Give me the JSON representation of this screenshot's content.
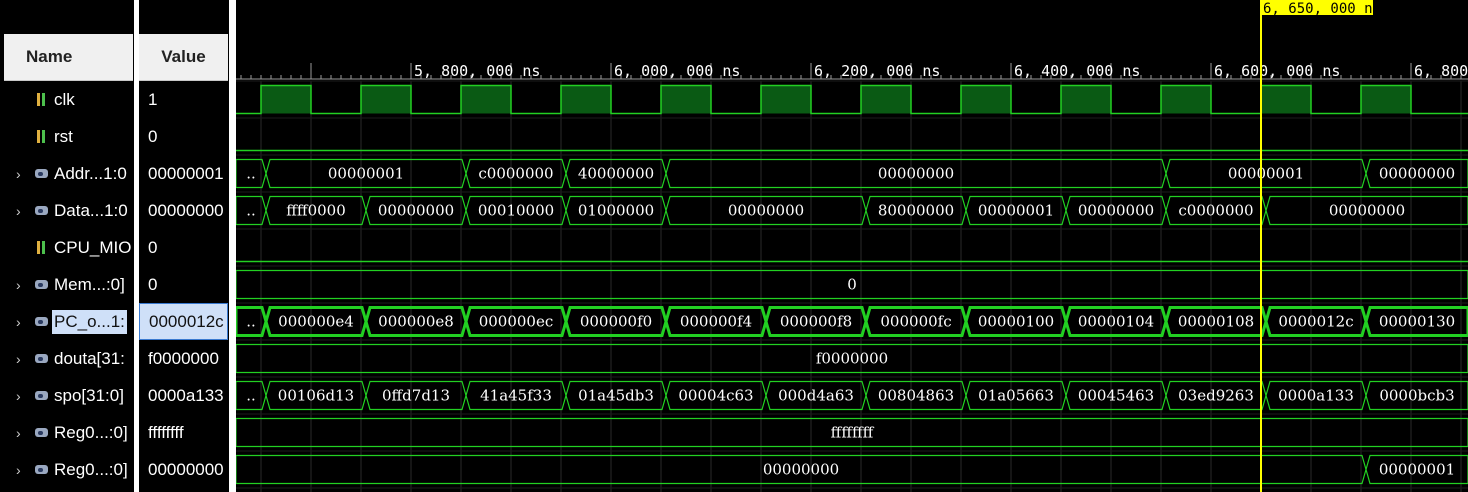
{
  "header": {
    "name_label": "Name",
    "value_label": "Value"
  },
  "timeline": {
    "unit": "ns",
    "visible_start_ns": 5625,
    "visible_end_ns": 6857,
    "labels": [
      "5, 800, 000 ns",
      "6, 000, 000 ns",
      "6, 200, 000 ns",
      "6, 400, 000 ns",
      "6, 600, 000 ns",
      "6, 800,"
    ],
    "label_times_ns": [
      5800,
      6000,
      6200,
      6400,
      6600,
      6800
    ],
    "cursor_label": "6, 650, 000 ns",
    "cursor_time_ns": 6650
  },
  "colors": {
    "wave": "#22d022",
    "wave_fill": "#0a5a14",
    "grid": "#2a2a2a",
    "cursor": "#ffff00",
    "selected_bg": "#cfe0f8"
  },
  "signals": [
    {
      "name": "clk",
      "value": "1",
      "kind": "bit",
      "icon": "bit-signal-icon",
      "expandable": false
    },
    {
      "name": "rst",
      "value": "0",
      "kind": "bit",
      "icon": "bit-signal-icon",
      "expandable": false
    },
    {
      "name": "Addr...1:0",
      "value": "00000001",
      "kind": "bus",
      "icon": "bus-signal-icon",
      "expandable": true
    },
    {
      "name": "Data...1:0",
      "value": "00000000",
      "kind": "bus",
      "icon": "bus-signal-icon",
      "expandable": true
    },
    {
      "name": "CPU_MIO",
      "value": "0",
      "kind": "bit",
      "icon": "bit-signal-icon",
      "expandable": false
    },
    {
      "name": "Mem...:0]",
      "value": "0",
      "kind": "bus",
      "icon": "bus-signal-icon",
      "expandable": true
    },
    {
      "name": "PC_o...1:",
      "value": "0000012c",
      "kind": "bus",
      "icon": "bus-signal-icon",
      "expandable": true,
      "selected": true
    },
    {
      "name": "douta[31:",
      "value": "f0000000",
      "kind": "bus",
      "icon": "bus-signal-icon",
      "expandable": true
    },
    {
      "name": "spo[31:0]",
      "value": "0000a133",
      "kind": "bus",
      "icon": "bus-signal-icon",
      "expandable": true
    },
    {
      "name": "Reg0...:0]",
      "value": "ffffffff",
      "kind": "bus",
      "icon": "bus-signal-icon",
      "expandable": true
    },
    {
      "name": "Reg0...:0]",
      "value": "00000000",
      "kind": "bus",
      "icon": "bus-signal-icon",
      "expandable": true
    }
  ],
  "waves": {
    "clk": {
      "period_ns": 100,
      "high_ranges": [
        [
          5650,
          5700
        ],
        [
          5750,
          5800
        ],
        [
          5850,
          5900
        ],
        [
          5950,
          6000
        ],
        [
          6050,
          6100
        ],
        [
          6150,
          6200
        ],
        [
          6250,
          6300
        ],
        [
          6350,
          6400
        ],
        [
          6450,
          6500
        ],
        [
          6550,
          6600
        ],
        [
          6650,
          6700
        ],
        [
          6750,
          6800
        ]
      ]
    },
    "rst": {
      "level": 0
    },
    "cpu_mio": {
      "level": 0
    },
    "buses": [
      {
        "row": 2,
        "segments": [
          {
            "start": 5625,
            "end": 5655,
            "label": ".."
          },
          {
            "start": 5655,
            "end": 5855,
            "label": "00000001"
          },
          {
            "start": 5855,
            "end": 5955,
            "label": "c0000000"
          },
          {
            "start": 5955,
            "end": 6055,
            "label": "40000000"
          },
          {
            "start": 6055,
            "end": 6555,
            "label": "00000000"
          },
          {
            "start": 6555,
            "end": 6755,
            "label": "00000001"
          },
          {
            "start": 6755,
            "end": 6857,
            "label": "00000000"
          }
        ]
      },
      {
        "row": 3,
        "segments": [
          {
            "start": 5625,
            "end": 5655,
            "label": ".."
          },
          {
            "start": 5655,
            "end": 5755,
            "label": "ffff0000"
          },
          {
            "start": 5755,
            "end": 5855,
            "label": "00000000"
          },
          {
            "start": 5855,
            "end": 5955,
            "label": "00010000"
          },
          {
            "start": 5955,
            "end": 6055,
            "label": "01000000"
          },
          {
            "start": 6055,
            "end": 6255,
            "label": "00000000"
          },
          {
            "start": 6255,
            "end": 6355,
            "label": "80000000"
          },
          {
            "start": 6355,
            "end": 6455,
            "label": "00000001"
          },
          {
            "start": 6455,
            "end": 6555,
            "label": "00000000"
          },
          {
            "start": 6555,
            "end": 6655,
            "label": "c0000000"
          },
          {
            "start": 6655,
            "end": 6857,
            "label": "00000000"
          }
        ]
      },
      {
        "row": 5,
        "segments": [
          {
            "start": 5625,
            "end": 6857,
            "label": "0"
          }
        ]
      },
      {
        "row": 6,
        "bold": true,
        "segments": [
          {
            "start": 5625,
            "end": 5655,
            "label": ".."
          },
          {
            "start": 5655,
            "end": 5755,
            "label": "000000e4"
          },
          {
            "start": 5755,
            "end": 5855,
            "label": "000000e8"
          },
          {
            "start": 5855,
            "end": 5955,
            "label": "000000ec"
          },
          {
            "start": 5955,
            "end": 6055,
            "label": "000000f0"
          },
          {
            "start": 6055,
            "end": 6155,
            "label": "000000f4"
          },
          {
            "start": 6155,
            "end": 6255,
            "label": "000000f8"
          },
          {
            "start": 6255,
            "end": 6355,
            "label": "000000fc"
          },
          {
            "start": 6355,
            "end": 6455,
            "label": "00000100"
          },
          {
            "start": 6455,
            "end": 6555,
            "label": "00000104"
          },
          {
            "start": 6555,
            "end": 6655,
            "label": "00000108"
          },
          {
            "start": 6655,
            "end": 6755,
            "label": "0000012c"
          },
          {
            "start": 6755,
            "end": 6857,
            "label": "00000130"
          }
        ]
      },
      {
        "row": 7,
        "segments": [
          {
            "start": 5625,
            "end": 6857,
            "label": "f0000000"
          }
        ]
      },
      {
        "row": 8,
        "segments": [
          {
            "start": 5625,
            "end": 5655,
            "label": ".."
          },
          {
            "start": 5655,
            "end": 5755,
            "label": "00106d13"
          },
          {
            "start": 5755,
            "end": 5855,
            "label": "0ffd7d13"
          },
          {
            "start": 5855,
            "end": 5955,
            "label": "41a45f33"
          },
          {
            "start": 5955,
            "end": 6055,
            "label": "01a45db3"
          },
          {
            "start": 6055,
            "end": 6155,
            "label": "00004c63"
          },
          {
            "start": 6155,
            "end": 6255,
            "label": "000d4a63"
          },
          {
            "start": 6255,
            "end": 6355,
            "label": "00804863"
          },
          {
            "start": 6355,
            "end": 6455,
            "label": "01a05663"
          },
          {
            "start": 6455,
            "end": 6555,
            "label": "00045463"
          },
          {
            "start": 6555,
            "end": 6655,
            "label": "03ed9263"
          },
          {
            "start": 6655,
            "end": 6755,
            "label": "0000a133"
          },
          {
            "start": 6755,
            "end": 6857,
            "label": "0000bcb3"
          }
        ]
      },
      {
        "row": 9,
        "segments": [
          {
            "start": 5625,
            "end": 6857,
            "label": "ffffffff"
          }
        ]
      },
      {
        "row": 10,
        "segments": [
          {
            "start": 5625,
            "end": 6755,
            "label": "00000000"
          },
          {
            "start": 6755,
            "end": 6857,
            "label": "00000001"
          }
        ]
      }
    ]
  }
}
